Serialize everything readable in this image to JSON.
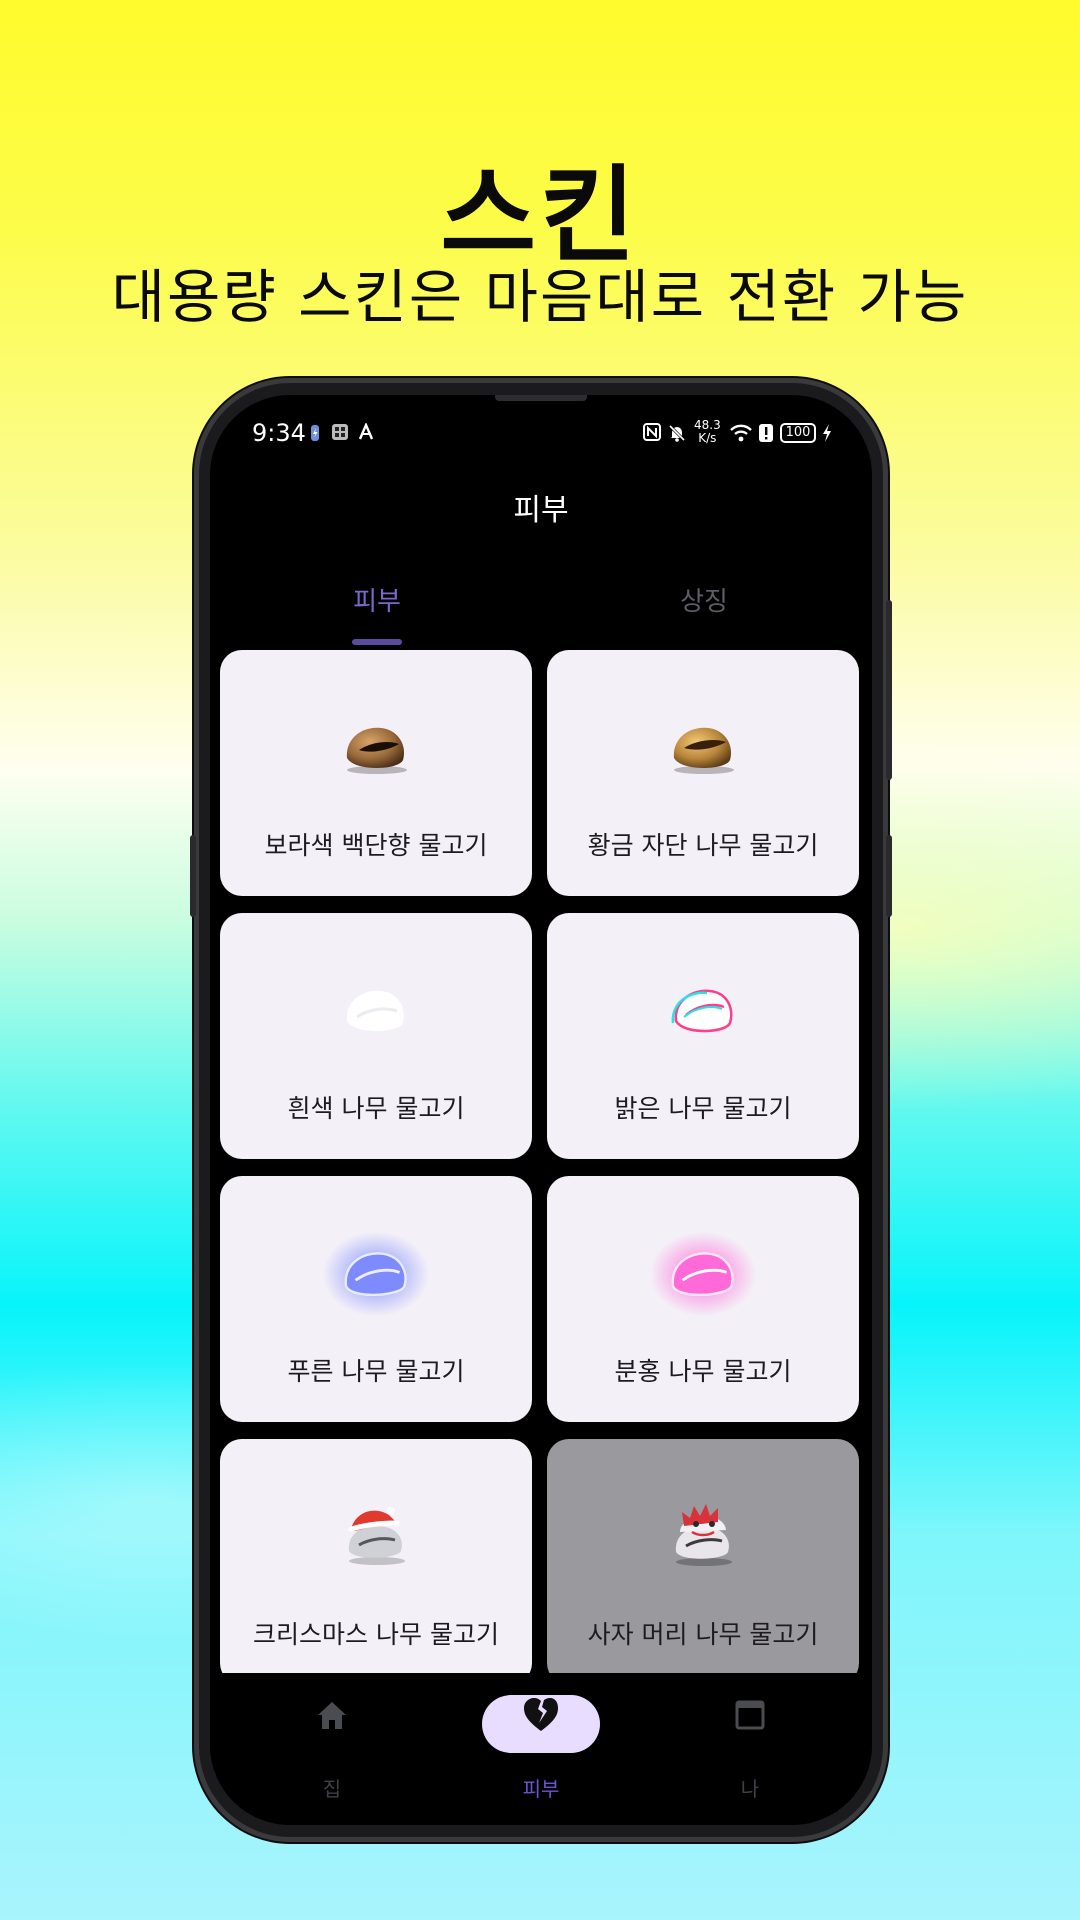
{
  "promo": {
    "headline": "스킨",
    "subline": "대용량 스킨은 마음대로 전환 가능"
  },
  "status_bar": {
    "time": "9:34",
    "net_speed_value": "48.3",
    "net_speed_unit": "K/s",
    "battery": "100"
  },
  "app": {
    "title": "피부",
    "tabs": [
      {
        "label": "피부",
        "active": true
      },
      {
        "label": "상징",
        "active": false
      }
    ]
  },
  "skins": [
    {
      "label": "보라색 백단향 물고기",
      "icon": "brown-wooden-fish-icon",
      "color": "#a0703c"
    },
    {
      "label": "황금 자단 나무 물고기",
      "icon": "golden-wooden-fish-icon",
      "color": "#c08a3a"
    },
    {
      "label": "흰색 나무 물고기",
      "icon": "white-wooden-fish-icon",
      "color": "#ffffff"
    },
    {
      "label": "밝은 나무 물고기",
      "icon": "bright-wooden-fish-icon",
      "color": "#ff3d8b"
    },
    {
      "label": "푸른 나무 물고기",
      "icon": "blue-wooden-fish-icon",
      "color": "#5a6cff"
    },
    {
      "label": "분홍 나무 물고기",
      "icon": "pink-wooden-fish-icon",
      "color": "#ff4fd0"
    },
    {
      "label": "크리스마스 나무 물고기",
      "icon": "christmas-wooden-fish-icon",
      "color": "#d9dadf"
    },
    {
      "label": "사자 머리 나무 물고기",
      "icon": "lion-head-wooden-fish-icon",
      "color": "#e8e6ea",
      "disabled": true
    }
  ],
  "bottom_nav": [
    {
      "label": "집",
      "icon": "home-icon",
      "active": false
    },
    {
      "label": "피부",
      "icon": "broken-heart-icon",
      "active": true
    },
    {
      "label": "나",
      "icon": "window-icon",
      "active": false
    }
  ],
  "colors": {
    "accent": "#7b68c8",
    "active_pill": "#e9ddff",
    "card_bg": "#f4f0f8"
  }
}
